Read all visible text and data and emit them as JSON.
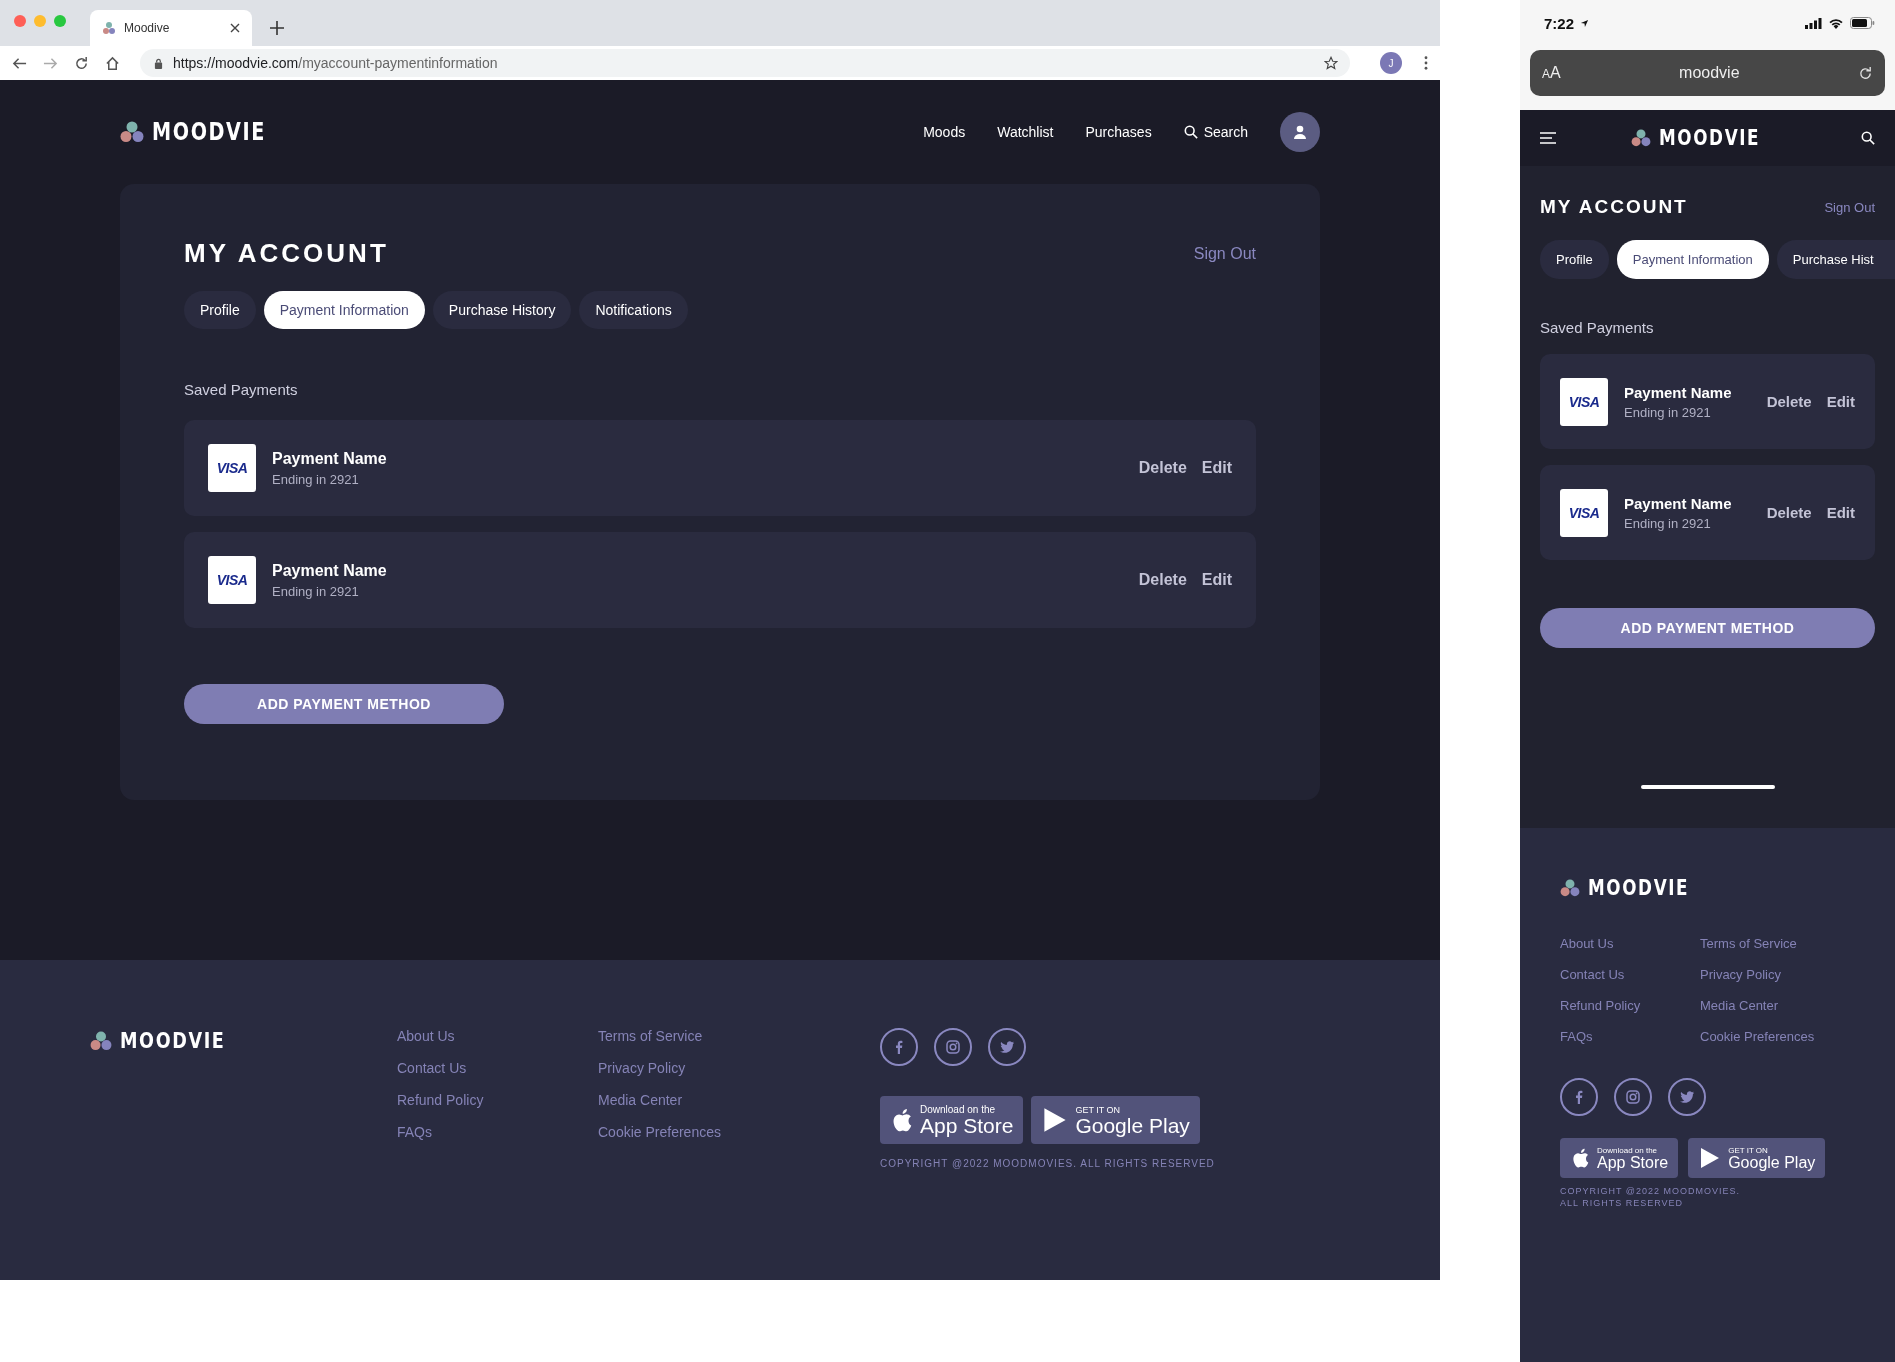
{
  "browser": {
    "tab_title": "Moodive",
    "url_host": "https://moodvie.com",
    "url_path": "/myaccount-paymentinformation",
    "profile_initial": "J"
  },
  "desktop": {
    "logo": "MOODVIE",
    "nav": [
      "Moods",
      "Watchlist",
      "Purchases"
    ],
    "search_label": "Search",
    "title": "MY ACCOUNT",
    "sign_out": "Sign Out",
    "tabs": [
      {
        "label": "Profile",
        "selected": false
      },
      {
        "label": "Payment Information",
        "selected": true
      },
      {
        "label": "Purchase History",
        "selected": false
      },
      {
        "label": "Notifications",
        "selected": false
      }
    ],
    "section_title": "Saved Payments",
    "payments": [
      {
        "brand": "VISA",
        "name": "Payment Name",
        "detail": "Ending in 2921",
        "actions": [
          "Delete",
          "Edit"
        ]
      },
      {
        "brand": "VISA",
        "name": "Payment Name",
        "detail": "Ending in 2921",
        "actions": [
          "Delete",
          "Edit"
        ]
      }
    ],
    "add_button": "ADD PAYMENT METHOD"
  },
  "desktop_footer": {
    "logo": "MOODVIE",
    "link_columns": [
      [
        "About Us",
        "Contact Us",
        "Refund Policy",
        "FAQs"
      ],
      [
        "Terms of Service",
        "Privacy Policy",
        "Media Center",
        "Cookie Preferences"
      ]
    ],
    "app_store": {
      "small": "Download on the",
      "big": "App Store"
    },
    "google_play": {
      "small": "GET IT ON",
      "big": "Google Play"
    },
    "copyright": "COPYRIGHT @2022 MOODMOVIES. ALL RIGHTS RESERVED"
  },
  "phone": {
    "time": "7:22",
    "text_size_button": "AA",
    "url": "moodvie",
    "logo": "MOODVIE",
    "title": "MY ACCOUNT",
    "sign_out": "Sign Out",
    "tabs": [
      {
        "label": "Profile",
        "selected": false
      },
      {
        "label": "Payment Information",
        "selected": true
      },
      {
        "label": "Purchase Hist",
        "selected": false
      }
    ],
    "section_title": "Saved Payments",
    "payments": [
      {
        "brand": "VISA",
        "name": "Payment Name",
        "detail": "Ending in 2921",
        "actions": [
          "Delete",
          "Edit"
        ]
      },
      {
        "brand": "VISA",
        "name": "Payment Name",
        "detail": "Ending in 2921",
        "actions": [
          "Delete",
          "Edit"
        ]
      }
    ],
    "add_button": "ADD PAYMENT METHOD"
  },
  "phone_footer": {
    "logo": "MOODVIE",
    "link_columns": [
      [
        "About Us",
        "Contact Us",
        "Refund Policy",
        "FAQs"
      ],
      [
        "Terms of Service",
        "Privacy Policy",
        "Media Center",
        "Cookie Preferences"
      ]
    ],
    "app_store": {
      "small": "Download on the",
      "big": "App Store"
    },
    "google_play": {
      "small": "GET IT ON",
      "big": "Google Play"
    },
    "copyright_lines": [
      "COPYRIGHT @2022 MOODMOVIES.",
      "ALL RIGHTS RESERVED"
    ]
  }
}
